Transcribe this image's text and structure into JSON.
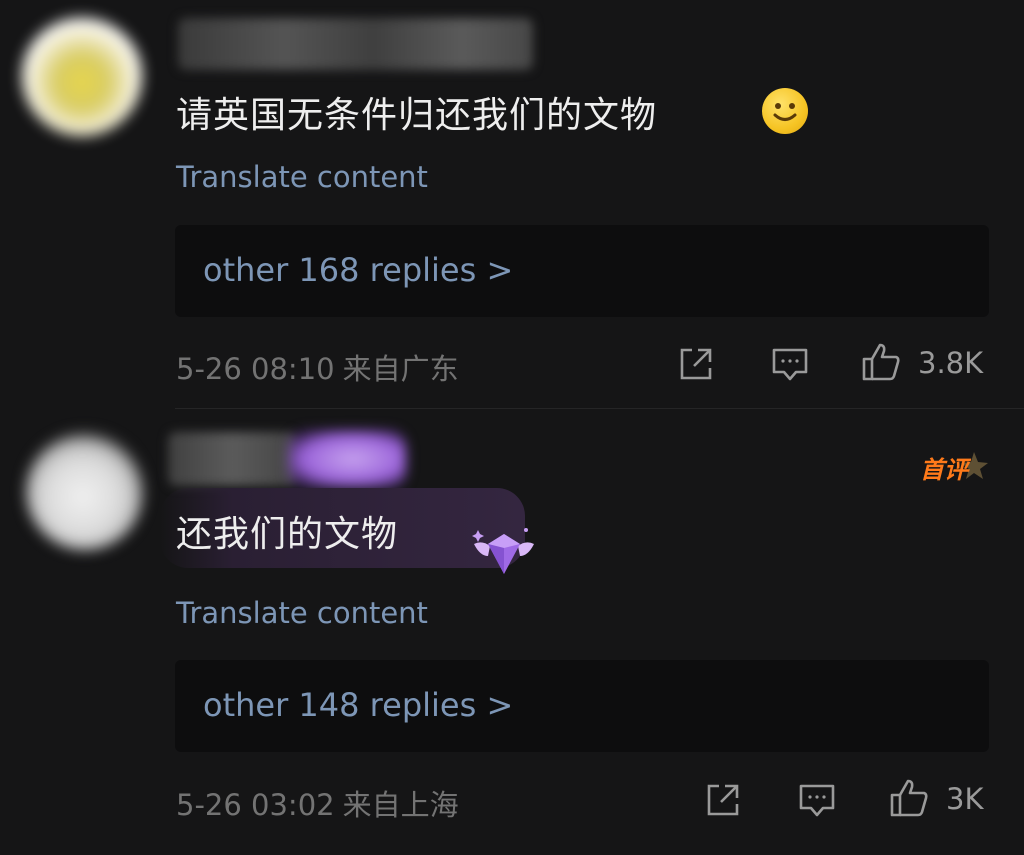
{
  "comments": [
    {
      "text": "请英国无条件归还我们的文物",
      "emoji": "slightly-smiling-face",
      "translate_label": "Translate content",
      "replies_label": "other 168 replies >",
      "date": "5-26 08:10",
      "location": "来自广东",
      "likes": "3.8K"
    },
    {
      "text": "还我们的文物",
      "badge_text": "首评",
      "translate_label": "Translate content",
      "replies_label": "other 148 replies >",
      "date": "5-26 03:02",
      "location": "来自上海",
      "likes": "3K"
    }
  ],
  "colors": {
    "background": "#151516",
    "link": "#7d96b6",
    "meta": "#737373",
    "first_badge": "#ff7a1a"
  }
}
